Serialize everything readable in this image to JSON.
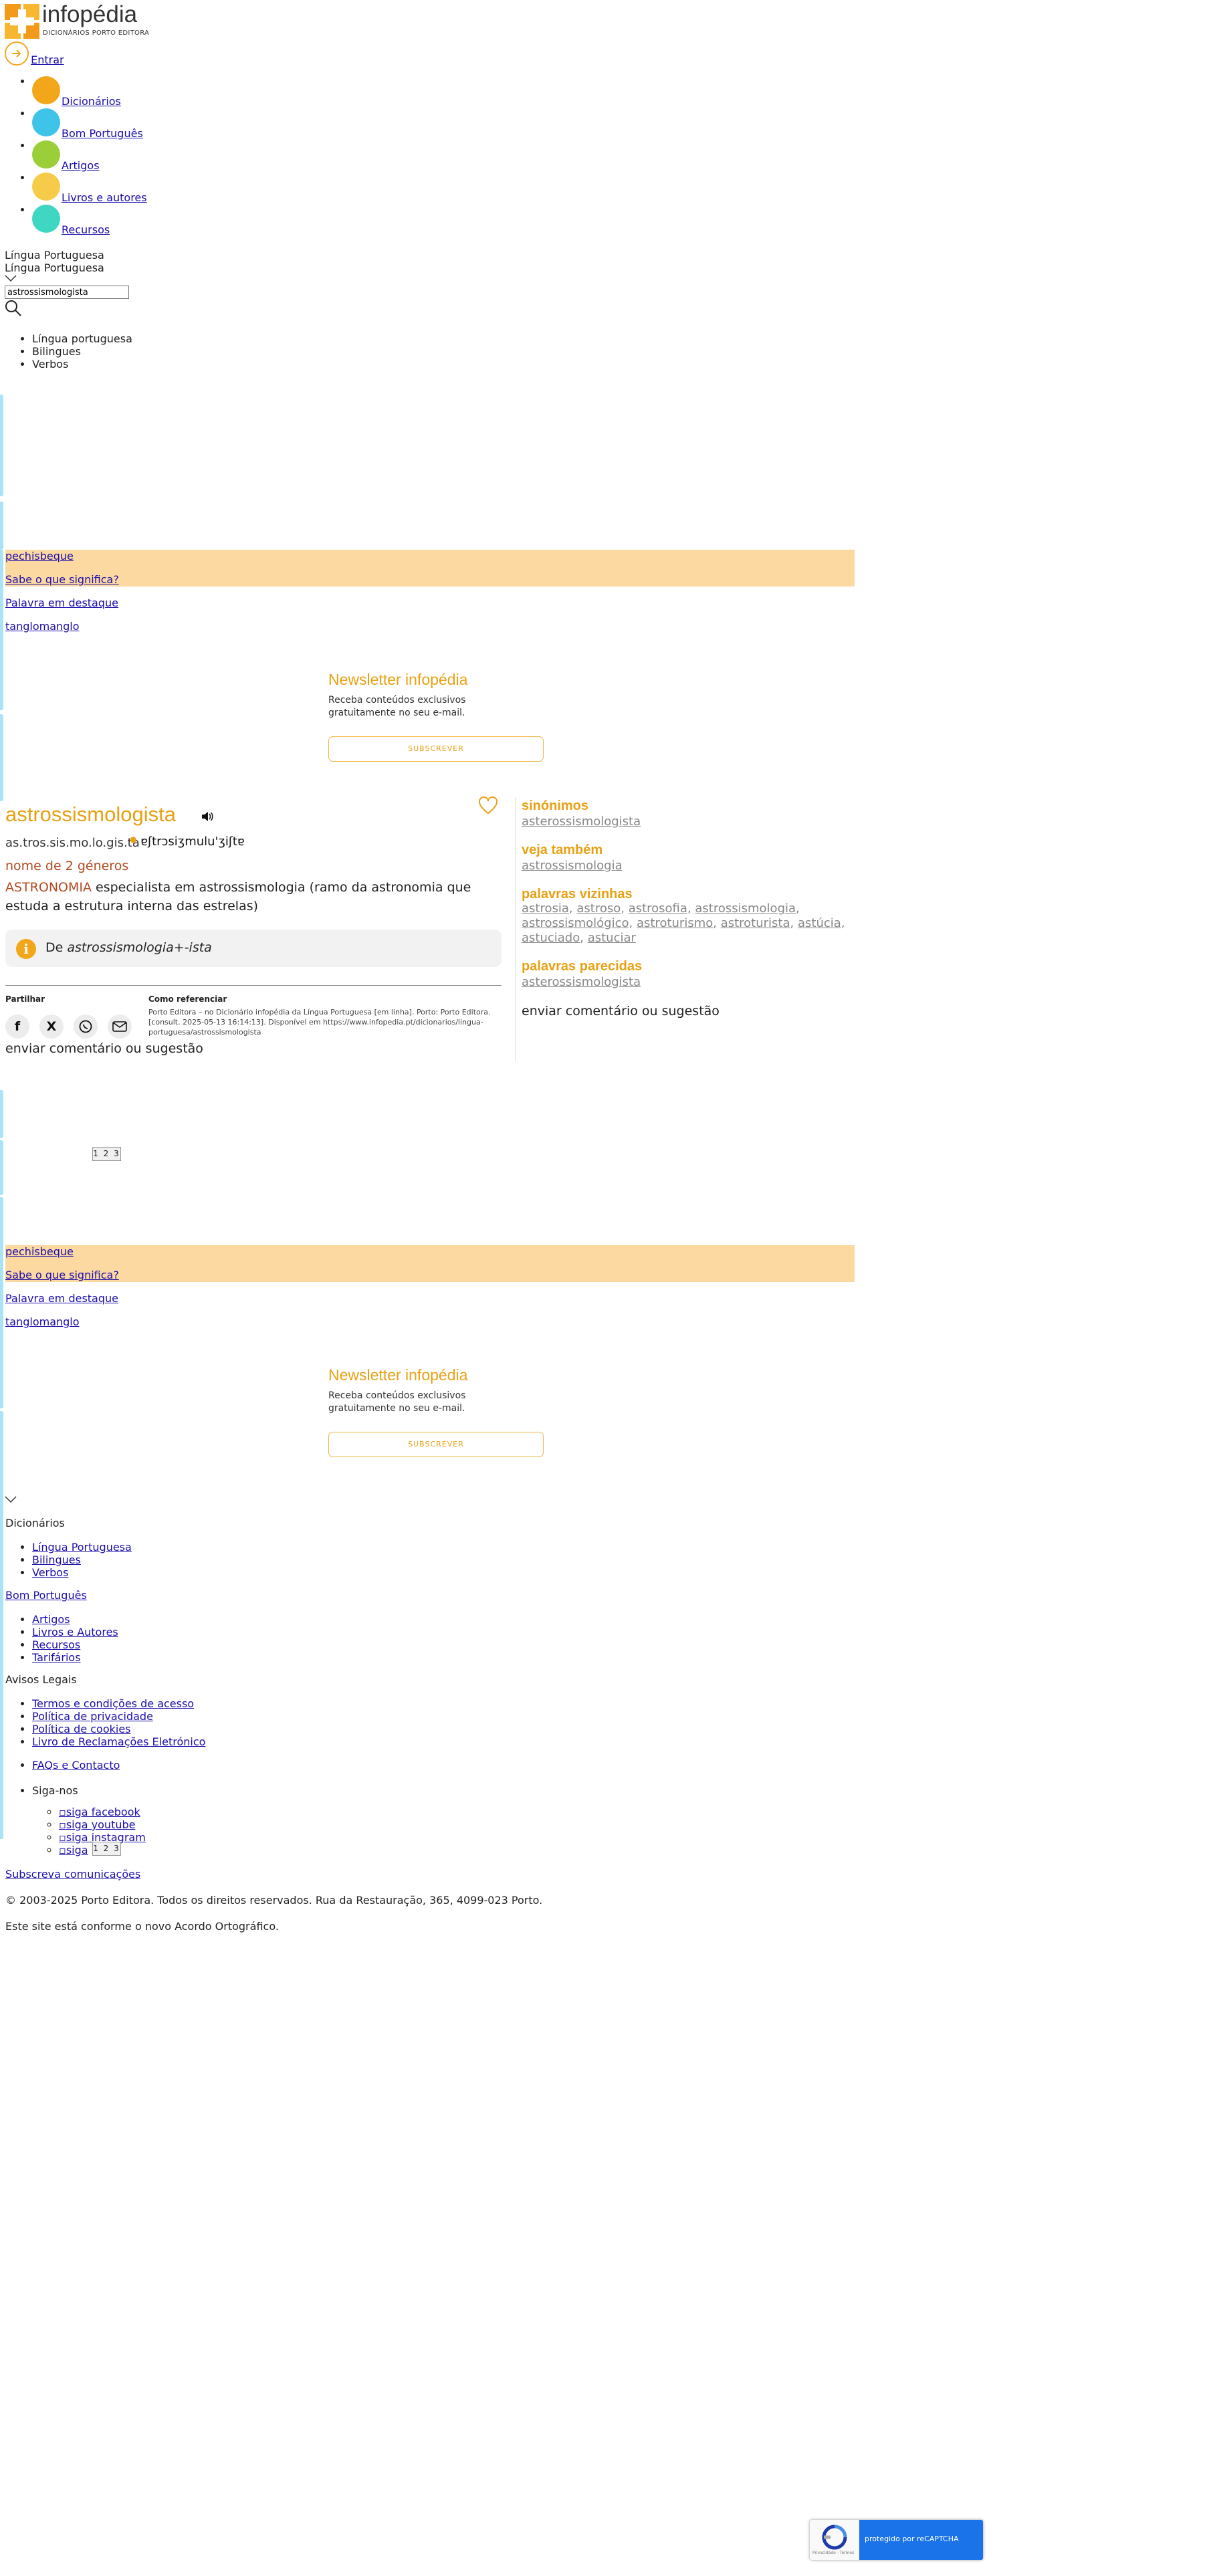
{
  "header": {
    "logo_text": "infopédia",
    "logo_sub": "DICIONÁRIOS PORTO EDITORA",
    "login_label": "Entrar",
    "nav": [
      {
        "label": "Dicionários",
        "color": "#f2a71b"
      },
      {
        "label": "Bom Português",
        "color": "#3dc4e8"
      },
      {
        "label": "Artigos",
        "color": "#9bcf3a"
      },
      {
        "label": "Livros e autores",
        "color": "#f7cb4a"
      },
      {
        "label": "Recursos",
        "color": "#3fd6c2"
      }
    ],
    "lang_current": "Língua Portuguesa",
    "lang_selected": "Língua Portuguesa",
    "search_value": "astrossismologista",
    "lang_options": [
      "Língua portuguesa",
      "Bilingues",
      "Verbos"
    ]
  },
  "wotd": {
    "word1": "pechisbeque",
    "question": "Sabe o que significa?",
    "featured_label": "Palavra em destaque",
    "word2": "tanglomanglo"
  },
  "newsletter": {
    "title": "Newsletter infopédia",
    "text": "Receba conteúdos exclusivos gratuitamente no seu e-mail.",
    "button": "SUBSCREVER"
  },
  "entry": {
    "headword": "astrossismologista",
    "syllables": "as.tros.sis.mo.lo.gis.ta",
    "ipa": "ɐʃtrɔsiʒmulu'ʒiʃtɐ",
    "pos": "nome de 2 géneros",
    "domain": "ASTRONOMIA",
    "definition": " especialista em astrossismologia (ramo da astronomia que estuda a estrutura interna das estrelas)",
    "etym_prefix": "De ",
    "etym_text": "astrossismologia+-ista",
    "share_title": "Partilhar",
    "cite_title": "Como referenciar",
    "cite_text": "Porto Editora – no Dicionário infopédia da Língua Portuguesa [em linha]. Porto: Porto Editora. [consult. 2025-05-13 16:14:13]. Disponível em https://www.infopedia.pt/dicionarios/lingua-portuguesa/astrossismologista",
    "feedback": "enviar comentário ou sugestão"
  },
  "sidebar": {
    "synonyms_title": "sinónimos",
    "synonyms": "asterossismologista",
    "see_also_title": "veja também",
    "see_also": "astrossismologia",
    "neighbors_title": "palavras vizinhas",
    "neighbors": [
      "astrosia",
      "astroso",
      "astrosofia",
      "astrossismologia",
      "astrossismológico",
      "astroturismo",
      "astroturista",
      "astúcia",
      "astuciado",
      "astuciar"
    ],
    "similar_title": "palavras parecidas",
    "similar": "asterossismologista",
    "feedback": "enviar comentário ou sugestão"
  },
  "pager_text": "1 2 3",
  "footer": {
    "dicionarios": "Dicionários",
    "dic_items": [
      "Língua Portuguesa",
      "Bilingues",
      "Verbos"
    ],
    "bom_portugues": "Bom Português",
    "more_items": [
      "Artigos",
      "Livros e Autores",
      "Recursos",
      "Tarifários"
    ],
    "legal_title": "Avisos Legais",
    "legal_items": [
      "Termos e condições de acesso",
      "Política de privacidade",
      "Política de cookies",
      "Livro de Reclamações Eletrónico"
    ],
    "faq": "FAQs e Contacto",
    "follow": "Siga-nos",
    "social": [
      "siga facebook",
      "siga youtube",
      "siga instagram",
      "siga"
    ],
    "subscribe": "Subscreva comunicações",
    "copyright": "© 2003-2025 Porto Editora. Todos os direitos reservados. Rua da Restauração, 365, 4099-023 Porto.",
    "ao": "Este site está conforme o novo Acordo Ortográfico."
  },
  "recaptcha": {
    "text": "protegido por reCAPTCHA",
    "small": "Privacidade - Termos"
  }
}
